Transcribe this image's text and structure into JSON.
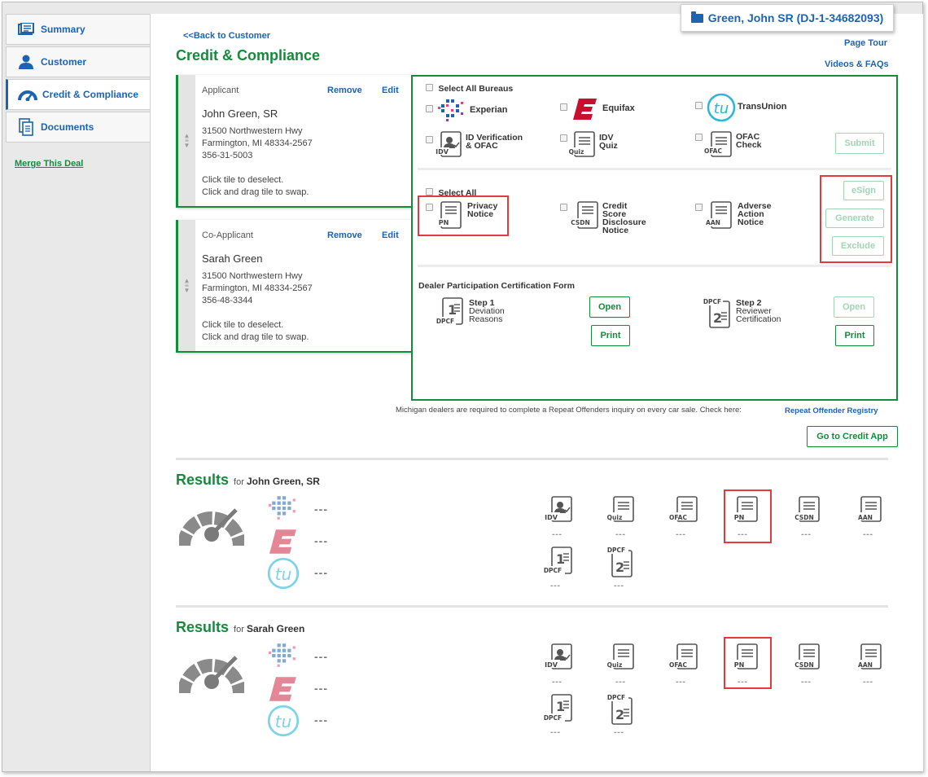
{
  "sidebar": {
    "items": [
      {
        "label": "Summary"
      },
      {
        "label": "Customer"
      },
      {
        "label": "Credit & Compliance"
      },
      {
        "label": "Documents"
      }
    ],
    "merge_link": "Merge This Deal"
  },
  "header": {
    "deal_badge": "Green, John SR (DJ-1-34682093)",
    "back_link": "<<Back to Customer",
    "title": "Credit & Compliance",
    "page_tour": "Page Tour",
    "videos": "Videos & FAQs"
  },
  "applicant": {
    "role": "Applicant",
    "remove": "Remove",
    "edit": "Edit",
    "name": "John Green, SR",
    "address1": "31500 Northwestern Hwy",
    "address2": "Farmington, MI 48334-2567",
    "ssn": "356-31-5003",
    "hint1": "Click tile to deselect.",
    "hint2": "Click and drag tile to swap."
  },
  "coapplicant": {
    "role": "Co-Applicant",
    "remove": "Remove",
    "edit": "Edit",
    "name": "Sarah Green",
    "address1": "31500 Northwestern Hwy",
    "address2": "Farmington, MI 48334-2567",
    "ssn": "356-48-3344",
    "hint1": "Click tile to deselect.",
    "hint2": "Click and drag tile to swap."
  },
  "bureaus": {
    "select_all": "Select All Bureaus",
    "experian": "Experian",
    "equifax": "Equifax",
    "transunion": "TransUnion",
    "idv_l1": "ID Verification",
    "idv_l2": "& OFAC",
    "idvquiz_l1": "IDV",
    "idvquiz_l2": "Quiz",
    "ofac_l1": "OFAC",
    "ofac_l2": "Check",
    "submit": "Submit"
  },
  "notices": {
    "select_all": "Select All",
    "pn_l1": "Privacy",
    "pn_l2": "Notice",
    "csdn_l1": "Credit",
    "csdn_l2": "Score",
    "csdn_l3": "Disclosure",
    "csdn_l4": "Notice",
    "aan_l1": "Adverse",
    "aan_l2": "Action",
    "aan_l3": "Notice",
    "esign": "eSign",
    "generate": "Generate",
    "exclude": "Exclude"
  },
  "dpcf": {
    "title": "Dealer Participation Certification Form",
    "step1_l1": "Step 1",
    "step1_l2": "Deviation",
    "step1_l3": "Reasons",
    "step2_l1": "Step 2",
    "step2_l2": "Reviewer",
    "step2_l3": "Certification",
    "open": "Open",
    "print": "Print"
  },
  "icon_text": {
    "idv": "IDV",
    "quiz": "Quiz",
    "ofac": "OFAC",
    "pn": "PN",
    "csdn": "CSDN",
    "aan": "AAN",
    "dpcf": "DPCF",
    "one": "1",
    "two": "2"
  },
  "michigan_note": "Michigan dealers are required to complete a Repeat Offenders inquiry on every car sale. Check here:",
  "repeat_offender_link": "Repeat Offender Registry",
  "go_credit_app": "Go to Credit App",
  "results": [
    {
      "title": "Results",
      "for_label": "for",
      "name": "John Green, SR"
    },
    {
      "title": "Results",
      "for_label": "for",
      "name": "Sarah Green"
    }
  ],
  "placeholder": "---",
  "colors": {
    "green": "#168a3c",
    "blue": "#1d63b0",
    "red_highlight": "#e23b3b",
    "equifax_red": "#c8102e",
    "transunion_blue": "#2ab6d8"
  }
}
